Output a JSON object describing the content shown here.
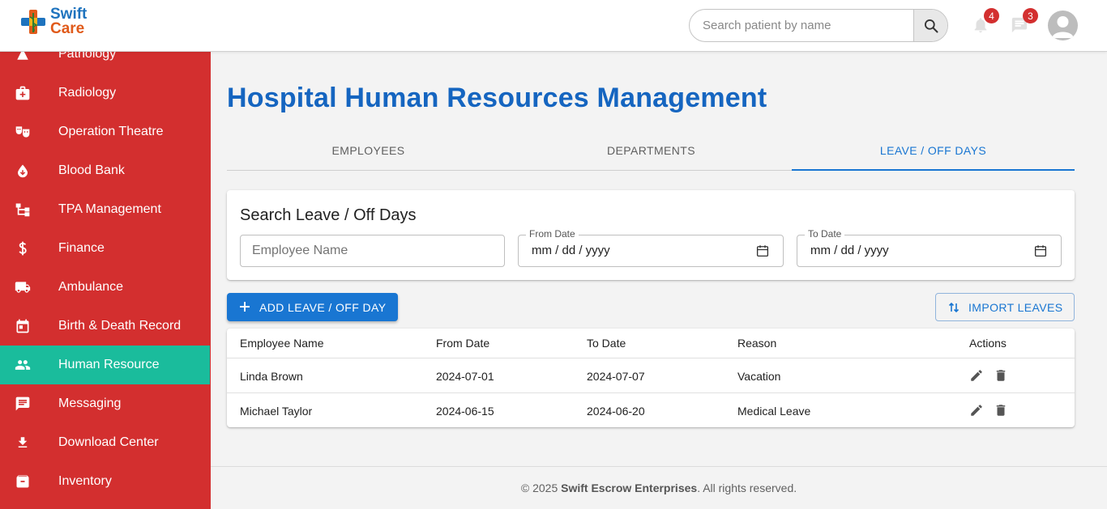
{
  "header": {
    "brand_line1": "Swift",
    "brand_line2": "Care",
    "search_placeholder": "Search patient by name",
    "notifications_count": "4",
    "messages_count": "3"
  },
  "sidebar": {
    "items": [
      {
        "label": "Pathology",
        "icon": "flask-icon"
      },
      {
        "label": "Radiology",
        "icon": "medical-kit-icon"
      },
      {
        "label": "Operation Theatre",
        "icon": "theater-masks-icon"
      },
      {
        "label": "Blood Bank",
        "icon": "blood-drop-icon"
      },
      {
        "label": "TPA Management",
        "icon": "hierarchy-icon"
      },
      {
        "label": "Finance",
        "icon": "dollar-icon"
      },
      {
        "label": "Ambulance",
        "icon": "truck-icon"
      },
      {
        "label": "Birth & Death Record",
        "icon": "calendar-icon"
      },
      {
        "label": "Human Resource",
        "icon": "people-icon",
        "active": true
      },
      {
        "label": "Messaging",
        "icon": "chat-icon"
      },
      {
        "label": "Download Center",
        "icon": "download-icon"
      },
      {
        "label": "Inventory",
        "icon": "archive-icon"
      }
    ],
    "color": "#d32f2f",
    "active_color": "#1abc9c"
  },
  "main": {
    "title": "Hospital Human Resources Management",
    "tabs": [
      {
        "label": "EMPLOYEES",
        "active": false
      },
      {
        "label": "DEPARTMENTS",
        "active": false
      },
      {
        "label": "LEAVE / OFF DAYS",
        "active": true
      }
    ],
    "search_card": {
      "heading": "Search Leave / Off Days",
      "employee_placeholder": "Employee Name",
      "from_label": "From Date",
      "from_value": "mm / dd / yyyy",
      "to_label": "To Date",
      "to_value": "mm / dd / yyyy"
    },
    "add_button": "ADD LEAVE / OFF DAY",
    "import_button": "IMPORT LEAVES",
    "table": {
      "columns": [
        "Employee Name",
        "From Date",
        "To Date",
        "Reason",
        "Actions"
      ],
      "rows": [
        [
          "Linda Brown",
          "2024-07-01",
          "2024-07-07",
          "Vacation"
        ],
        [
          "Michael Taylor",
          "2024-06-15",
          "2024-06-20",
          "Medical Leave"
        ]
      ]
    },
    "accent_color": "#1565c0"
  },
  "footer": {
    "prefix": "© 2025 ",
    "company": "Swift Escrow Enterprises",
    "suffix": ". All rights reserved."
  }
}
